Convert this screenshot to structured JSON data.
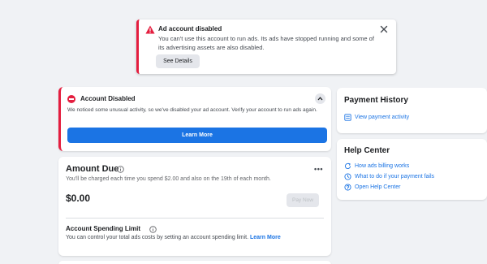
{
  "alert": {
    "title": "Ad account disabled",
    "body": "You can't use this account to run ads. Its ads have stopped running and some of its advertising assets are also disabled.",
    "details_button": "See Details",
    "accent_color": "#e41e3f"
  },
  "disabled_card": {
    "title": "Account Disabled",
    "body": "We noticed some unusual activity, so we've disabled your ad account. Verify your account to run ads again.",
    "button": "Learn More"
  },
  "amount_due": {
    "title": "Amount Due",
    "subtitle": "You'll be charged each time you spend $2.00 and also on the 19th of each month.",
    "value": "$0.00",
    "pay_button": "Pay Now",
    "more_label": "•••",
    "spending_limit": {
      "title": "Account Spending Limit",
      "body": "You can control your total ads costs by setting an account spending limit.",
      "link": "Learn More"
    }
  },
  "payment_history": {
    "title": "Payment History",
    "link": "View payment activity",
    "link_icon": "receipt-icon"
  },
  "help_center": {
    "title": "Help Center",
    "links": [
      {
        "label": "How ads billing works",
        "icon": "refresh-icon"
      },
      {
        "label": "What to do if your payment fails",
        "icon": "clock-icon"
      },
      {
        "label": "Open Help Center",
        "icon": "question-icon"
      }
    ]
  },
  "colors": {
    "link": "#1b74e4",
    "danger": "#e41e3f",
    "background": "#f0f2f5"
  }
}
